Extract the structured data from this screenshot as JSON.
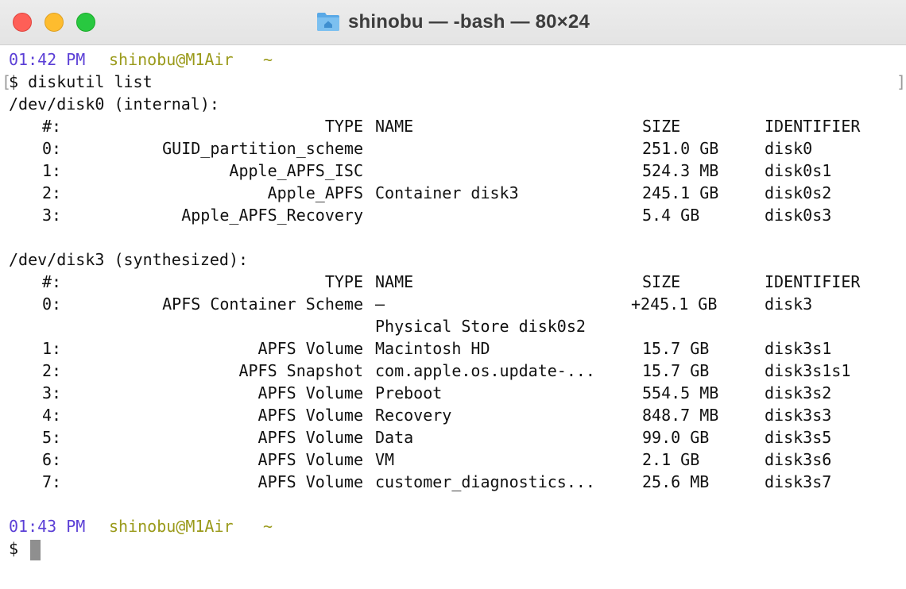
{
  "window": {
    "title": "shinobu — -bash — 80×24"
  },
  "prompt1": {
    "time": "01:42 PM",
    "user_host": "shinobu@M1Air",
    "dir": "~",
    "command": "$ diskutil list"
  },
  "disk0": {
    "header": "/dev/disk0 (internal):",
    "col_num": "#:",
    "col_type": "TYPE",
    "col_name": "NAME",
    "col_size": "SIZE",
    "col_id": "IDENTIFIER",
    "rows": [
      {
        "num": "0:",
        "type": "GUID_partition_scheme",
        "name": "",
        "size": "251.0 GB",
        "id": "disk0"
      },
      {
        "num": "1:",
        "type": "Apple_APFS_ISC",
        "name": "",
        "size": "524.3 MB",
        "id": "disk0s1"
      },
      {
        "num": "2:",
        "type": "Apple_APFS",
        "name": "Container disk3",
        "size": "245.1 GB",
        "id": "disk0s2"
      },
      {
        "num": "3:",
        "type": "Apple_APFS_Recovery",
        "name": "",
        "size": "5.4 GB",
        "id": "disk0s3"
      }
    ]
  },
  "disk3": {
    "header": "/dev/disk3 (synthesized):",
    "col_num": "#:",
    "col_type": "TYPE",
    "col_name": "NAME",
    "col_size": "SIZE",
    "col_id": "IDENTIFIER",
    "scheme_row": {
      "num": "0:",
      "type": "APFS Container Scheme",
      "name": "–",
      "size": "+245.1 GB",
      "id": "disk3"
    },
    "scheme_continuation": "Physical Store disk0s2",
    "rows": [
      {
        "num": "1:",
        "type": "APFS Volume",
        "name": "Macintosh HD",
        "size": "15.7 GB",
        "id": "disk3s1"
      },
      {
        "num": "2:",
        "type": "APFS Snapshot",
        "name": "com.apple.os.update-...",
        "size": "15.7 GB",
        "id": "disk3s1s1"
      },
      {
        "num": "3:",
        "type": "APFS Volume",
        "name": "Preboot",
        "size": "554.5 MB",
        "id": "disk3s2"
      },
      {
        "num": "4:",
        "type": "APFS Volume",
        "name": "Recovery",
        "size": "848.7 MB",
        "id": "disk3s3"
      },
      {
        "num": "5:",
        "type": "APFS Volume",
        "name": "Data",
        "size": "99.0 GB",
        "id": "disk3s5"
      },
      {
        "num": "6:",
        "type": "APFS Volume",
        "name": "VM",
        "size": "2.1 GB",
        "id": "disk3s6"
      },
      {
        "num": "7:",
        "type": "APFS Volume",
        "name": "customer_diagnostics...",
        "size": "25.6 MB",
        "id": "disk3s7"
      }
    ]
  },
  "prompt2": {
    "time": "01:43 PM",
    "user_host": "shinobu@M1Air",
    "dir": "~",
    "symbol": "$"
  },
  "colors": {
    "time": "#5b3fd6",
    "user_host": "#9a9a1a",
    "close": "#fe5f57",
    "minimize": "#febc2e",
    "maximize": "#28c840"
  }
}
